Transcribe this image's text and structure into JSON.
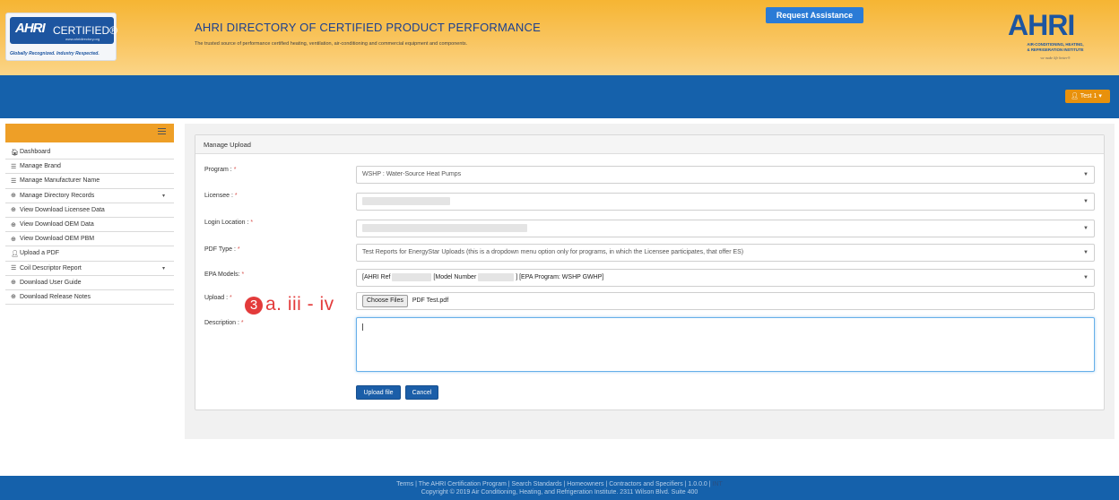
{
  "header": {
    "logo": {
      "mark": "AHRI",
      "cert": "CERTIFIED®",
      "url": "www.ahridirectory.org",
      "tagline": "Globally Recognized. Industry Respected."
    },
    "title": "AHRI DIRECTORY OF CERTIFIED PRODUCT PERFORMANCE",
    "subtitle": "The trusted source of performance certified heating, ventilation, air-conditioning and commercial equipment and components.",
    "request_assistance": "Request Assistance",
    "ahri_logo": {
      "word": "AHRI",
      "line1": "AIR-CONDITIONING, HEATING,",
      "line2": "& REFRIGERATION INSTITUTE",
      "tagline": "we make life better®"
    },
    "brand_color": "#f6b533"
  },
  "topbar": {
    "user_label": "Test 1 ▾",
    "color": "#1561ab"
  },
  "sidebar": {
    "items": [
      {
        "label": "Dashboard",
        "icon": "home-icon",
        "glyph": "🏠︎"
      },
      {
        "label": "Manage Brand",
        "icon": "list-icon",
        "glyph": "☰"
      },
      {
        "label": "Manage Manufacturer Name",
        "icon": "list-icon",
        "glyph": "☰"
      },
      {
        "label": "Manage Directory Records",
        "icon": "circle-plus-icon",
        "glyph": "⊕",
        "caret": "▾"
      },
      {
        "label": "View Download Licensee Data",
        "icon": "circle-plus-icon",
        "glyph": "⊕"
      },
      {
        "label": "View Download OEM Data",
        "icon": "circle-plus-icon",
        "glyph": "⊕"
      },
      {
        "label": "View Download OEM PBM",
        "icon": "circle-plus-icon",
        "glyph": "⊕"
      },
      {
        "label": "Upload a PDF",
        "icon": "user-icon",
        "glyph": "👤︎"
      },
      {
        "label": "Coil Descriptor Report",
        "icon": "list-icon",
        "glyph": "☰",
        "caret": "▾"
      },
      {
        "label": "Download User Guide",
        "icon": "circle-plus-icon",
        "glyph": "⊕"
      },
      {
        "label": "Download Release Notes",
        "icon": "circle-plus-icon",
        "glyph": "⊕"
      }
    ]
  },
  "form": {
    "panel_title": "Manage Upload",
    "program_label": "Program :",
    "program_value": "WSHP : Water-Source Heat Pumps",
    "licensee_label": "Licensee :",
    "login_location_label": "Login Location :",
    "pdf_type_label": "PDF Type :",
    "pdf_type_value": "Test Reports for EnergyStar Uploads (this is a dropdown menu option only for programs, in which the Licensee participates, that offer ES)",
    "epa_models_label": "EPA Models:",
    "epa_part1": "[AHRI Ref",
    "epa_part2": "[Model Number",
    "epa_part3": "] [EPA Program: WSHP GWHP]",
    "upload_label": "Upload :",
    "choose_files": "Choose Files",
    "file_name": "PDF Test.pdf",
    "description_label": "Description :",
    "required_marker": "*",
    "upload_button": "Upload file",
    "cancel_button": "Cancel"
  },
  "annotation": {
    "number": "3",
    "text": "a. iii - iv",
    "color": "#e33b3b"
  },
  "footer": {
    "links": "Terms  |  The AHRI Certification Program  |  Search Standards  |  Homeowners  |  Contractors and Specifiers  |  1.0.0.0  |",
    "env": "INT",
    "copyright": "Copyright © 2019 Air Conditioning, Heating, and Refrigeration Institute. 2311 Wilson Blvd. Suite 400"
  }
}
